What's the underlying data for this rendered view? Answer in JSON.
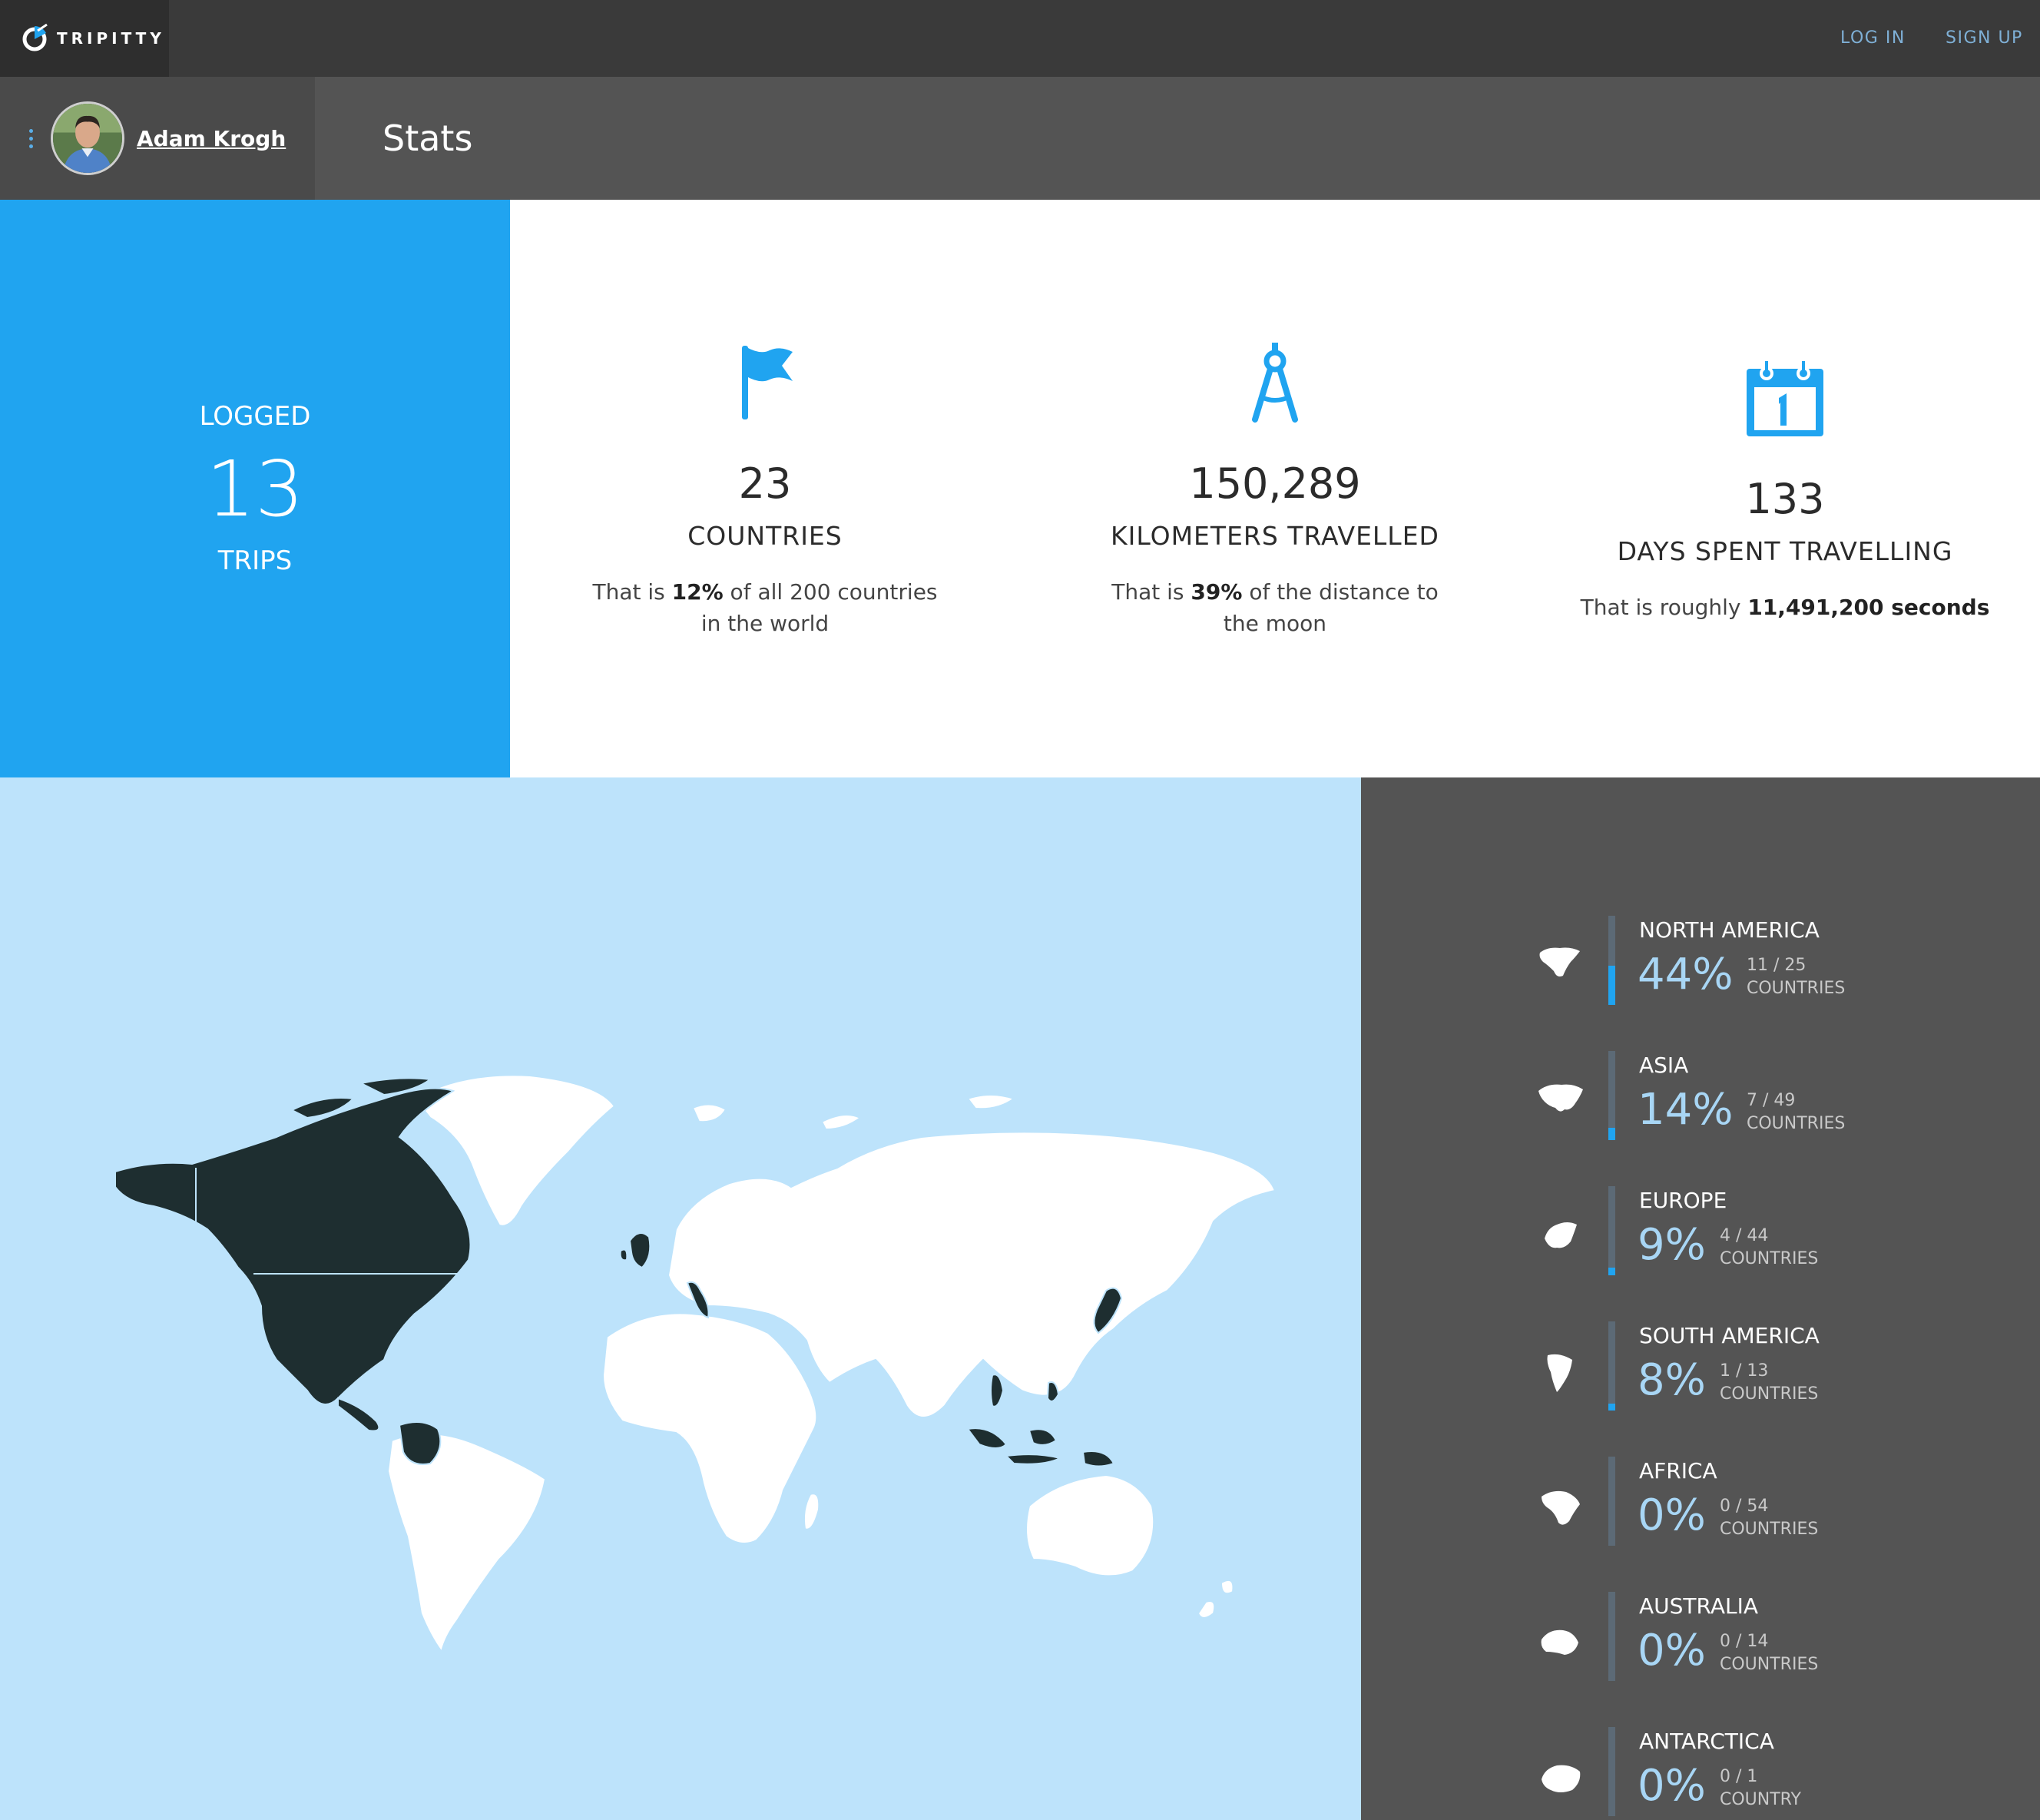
{
  "nav": {
    "brand": "TRIPITTY",
    "login": "LOG IN",
    "signup": "SIGN UP"
  },
  "header": {
    "user_name": "Adam Krogh",
    "page_title": "Stats"
  },
  "logged": {
    "label": "LOGGED",
    "count": "13",
    "unit": "TRIPS"
  },
  "stats": {
    "countries": {
      "icon": "flag-icon",
      "value": "23",
      "label": "COUNTRIES",
      "desc_pre": "That is ",
      "desc_bold": "12%",
      "desc_post": " of all 200 countries in the world"
    },
    "distance": {
      "icon": "compass-icon",
      "value": "150,289",
      "label": "KILOMETERS TRAVELLED",
      "desc_pre": "That is ",
      "desc_bold": "39%",
      "desc_post": " of the distance to the moon"
    },
    "days": {
      "icon": "calendar-icon",
      "value": "133",
      "label": "DAYS SPENT TRAVELLING",
      "desc_pre": "That is roughly ",
      "desc_bold": "11,491,200 seconds",
      "desc_post": ""
    }
  },
  "continents": [
    {
      "name": "NORTH AMERICA",
      "pct": "44%",
      "fraction": "11 / 25",
      "unit": "COUNTRIES",
      "level": 0.44,
      "icon": "north-america-icon"
    },
    {
      "name": "ASIA",
      "pct": "14%",
      "fraction": "7 / 49",
      "unit": "COUNTRIES",
      "level": 0.14,
      "icon": "asia-icon"
    },
    {
      "name": "EUROPE",
      "pct": "9%",
      "fraction": "4 / 44",
      "unit": "COUNTRIES",
      "level": 0.09,
      "icon": "europe-icon"
    },
    {
      "name": "SOUTH AMERICA",
      "pct": "8%",
      "fraction": "1 / 13",
      "unit": "COUNTRIES",
      "level": 0.08,
      "icon": "south-america-icon"
    },
    {
      "name": "AFRICA",
      "pct": "0%",
      "fraction": "0 / 54",
      "unit": "COUNTRIES",
      "level": 0,
      "icon": "africa-icon"
    },
    {
      "name": "AUSTRALIA",
      "pct": "0%",
      "fraction": "0 / 14",
      "unit": "COUNTRIES",
      "level": 0,
      "icon": "australia-icon"
    },
    {
      "name": "ANTARCTICA",
      "pct": "0%",
      "fraction": "0 / 1",
      "unit": "COUNTRY",
      "level": 0,
      "icon": "antarctica-icon"
    }
  ],
  "colors": {
    "accent": "#20a4f0",
    "visited": "#1e2e30",
    "land": "#ffffff",
    "ocean": "#bde3fb"
  }
}
